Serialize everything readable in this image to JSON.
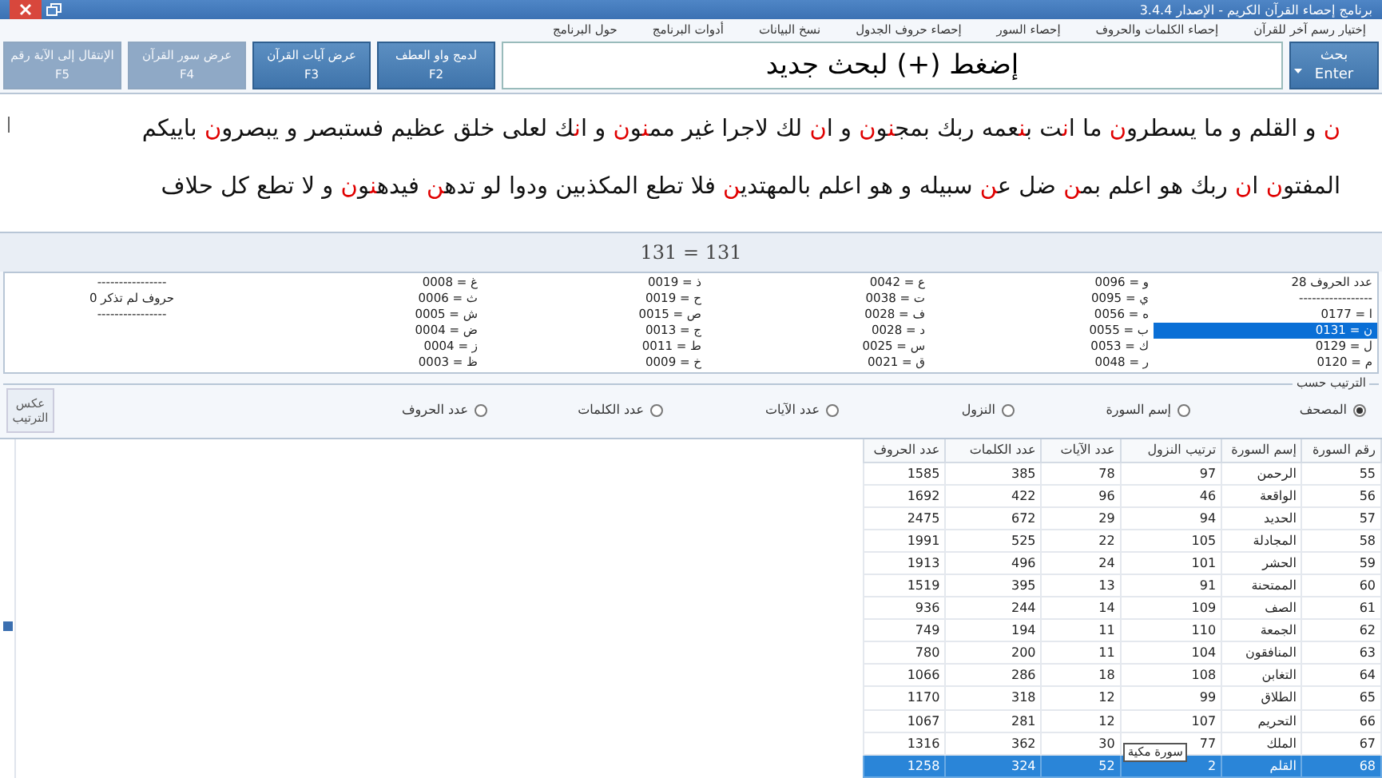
{
  "window": {
    "title": "برنامج إحصاء القرآن الكريم - الإصدار 3.4.4"
  },
  "menu": [
    "إختيار رسم آخر للقرآن",
    "إحصاء الكلمات والحروف",
    "إحصاء السور",
    "إحصاء حروف الجدول",
    "نسخ البيانات",
    "أدوات البرنامج",
    "حول البرنامج"
  ],
  "search_button": {
    "label": "بحث",
    "key": "Enter"
  },
  "search_field": {
    "placeholder": "إضغط (+) لبحث جديد"
  },
  "buttons": [
    {
      "label": "لدمج واو العطف",
      "key": "F2",
      "disabled": false
    },
    {
      "label": "عرض آيات القرآن",
      "key": "F3",
      "disabled": false
    },
    {
      "label": "عرض سور القرآن",
      "key": "F4",
      "disabled": true
    },
    {
      "label": "الإنتقال إلى الآية رقم",
      "key": "F5",
      "disabled": true
    }
  ],
  "verse_lines": [
    [
      {
        "text": "ن",
        "highlight": true
      },
      {
        "text": " و القلم و ما يسطرو",
        "highlight": false
      },
      {
        "text": "ن",
        "highlight": true
      },
      {
        "text": " ما ا",
        "highlight": false
      },
      {
        "text": "ن",
        "highlight": true
      },
      {
        "text": "ت ب",
        "highlight": false
      },
      {
        "text": "ن",
        "highlight": true
      },
      {
        "text": "عمه ربك بمج",
        "highlight": false
      },
      {
        "text": "ن",
        "highlight": true
      },
      {
        "text": "و",
        "highlight": false
      },
      {
        "text": "ن",
        "highlight": true
      },
      {
        "text": " و ا",
        "highlight": false
      },
      {
        "text": "ن",
        "highlight": true
      },
      {
        "text": " لك لاجرا غير مم",
        "highlight": false
      },
      {
        "text": "ن",
        "highlight": true
      },
      {
        "text": "و",
        "highlight": false
      },
      {
        "text": "ن",
        "highlight": true
      },
      {
        "text": " و ا",
        "highlight": false
      },
      {
        "text": "ن",
        "highlight": true
      },
      {
        "text": "ك لعلى خلق عظيم فستبصر و يبصرو",
        "highlight": false
      },
      {
        "text": "ن",
        "highlight": true
      },
      {
        "text": " باييكم",
        "highlight": false
      }
    ],
    [
      {
        "text": "المفتو",
        "highlight": false
      },
      {
        "text": "ن",
        "highlight": true
      },
      {
        "text": " ا",
        "highlight": false
      },
      {
        "text": "ن",
        "highlight": true
      },
      {
        "text": " ربك هو اعلم بم",
        "highlight": false
      },
      {
        "text": "ن",
        "highlight": true
      },
      {
        "text": " ضل ع",
        "highlight": false
      },
      {
        "text": "ن",
        "highlight": true
      },
      {
        "text": " سبيله و هو اعلم بالمهتدي",
        "highlight": false
      },
      {
        "text": "ن",
        "highlight": true
      },
      {
        "text": " فلا تطع المكذبين ودوا لو تده",
        "highlight": false
      },
      {
        "text": "ن",
        "highlight": true
      },
      {
        "text": " فيده",
        "highlight": false
      },
      {
        "text": "ن",
        "highlight": true
      },
      {
        "text": "و",
        "highlight": false
      },
      {
        "text": "ن",
        "highlight": true
      },
      {
        "text": " و لا تطع كل حلاف",
        "highlight": false
      }
    ]
  ],
  "equation": "131  =  131",
  "letter_counts": [
    [
      {
        "text": "عدد الحروف 28",
        "selected": false
      },
      {
        "text": "-----------------",
        "selected": false
      },
      {
        "text": "ا = 0177",
        "selected": false
      },
      {
        "text": "ن = 0131",
        "selected": true
      },
      {
        "text": "ل = 0129",
        "selected": false
      },
      {
        "text": "م = 0120",
        "selected": false
      }
    ],
    [
      {
        "text": "و = 0096",
        "selected": false
      },
      {
        "text": "ي = 0095",
        "selected": false
      },
      {
        "text": "ه = 0056",
        "selected": false
      },
      {
        "text": "ب = 0055",
        "selected": false
      },
      {
        "text": "ك = 0053",
        "selected": false
      },
      {
        "text": "ر = 0048",
        "selected": false
      }
    ],
    [
      {
        "text": "ع = 0042",
        "selected": false
      },
      {
        "text": "ت = 0038",
        "selected": false
      },
      {
        "text": "ف = 0028",
        "selected": false
      },
      {
        "text": "د = 0028",
        "selected": false
      },
      {
        "text": "س = 0025",
        "selected": false
      },
      {
        "text": "ق = 0021",
        "selected": false
      }
    ],
    [
      {
        "text": "ذ = 0019",
        "selected": false
      },
      {
        "text": "ح = 0019",
        "selected": false
      },
      {
        "text": "ص = 0015",
        "selected": false
      },
      {
        "text": "ج = 0013",
        "selected": false
      },
      {
        "text": "ط = 0011",
        "selected": false
      },
      {
        "text": "خ = 0009",
        "selected": false
      }
    ],
    [
      {
        "text": "غ = 0008",
        "selected": false
      },
      {
        "text": "ث = 0006",
        "selected": false
      },
      {
        "text": "ش = 0005",
        "selected": false
      },
      {
        "text": "ض = 0004",
        "selected": false
      },
      {
        "text": "ز = 0004",
        "selected": false
      },
      {
        "text": "ظ = 0003",
        "selected": false
      }
    ],
    [
      {
        "text": "----------------",
        "selected": false
      },
      {
        "text": "حروف لم تذكر 0",
        "selected": false
      },
      {
        "text": "----------------",
        "selected": false
      }
    ]
  ],
  "sort": {
    "title": "الترتيب حسب",
    "options": [
      {
        "label": "المصحف",
        "selected": true
      },
      {
        "label": "إسم السورة",
        "selected": false
      },
      {
        "label": "النزول",
        "selected": false
      },
      {
        "label": "عدد الآيات",
        "selected": false
      },
      {
        "label": "عدد الكلمات",
        "selected": false
      },
      {
        "label": "عدد الحروف",
        "selected": false
      }
    ],
    "reverse_button": "عكس الترتيب"
  },
  "table": {
    "columns": [
      "رقم السورة",
      "إسم السورة",
      "ترتيب النزول",
      "عدد الآيات",
      "عدد الكلمات",
      "عدد الحروف"
    ],
    "rows": [
      {
        "cells": [
          "55",
          "الرحمن",
          "97",
          "78",
          "385",
          "1585"
        ],
        "selected": false
      },
      {
        "cells": [
          "56",
          "الواقعة",
          "46",
          "96",
          "422",
          "1692"
        ],
        "selected": false
      },
      {
        "cells": [
          "57",
          "الحديد",
          "94",
          "29",
          "672",
          "2475"
        ],
        "selected": false
      },
      {
        "cells": [
          "58",
          "المجادلة",
          "105",
          "22",
          "525",
          "1991"
        ],
        "selected": false
      },
      {
        "cells": [
          "59",
          "الحشر",
          "101",
          "24",
          "496",
          "1913"
        ],
        "selected": false
      },
      {
        "cells": [
          "60",
          "الممتحنة",
          "91",
          "13",
          "395",
          "1519"
        ],
        "selected": false
      },
      {
        "cells": [
          "61",
          "الصف",
          "109",
          "14",
          "244",
          "936"
        ],
        "selected": false
      },
      {
        "cells": [
          "62",
          "الجمعة",
          "110",
          "11",
          "194",
          "749"
        ],
        "selected": false
      },
      {
        "cells": [
          "63",
          "المنافقون",
          "104",
          "11",
          "200",
          "780"
        ],
        "selected": false
      },
      {
        "cells": [
          "64",
          "التغابن",
          "108",
          "18",
          "286",
          "1066"
        ],
        "selected": false
      },
      {
        "cells": [
          "65",
          "الطلاق",
          "99",
          "12",
          "318",
          "1170"
        ],
        "selected": false
      },
      {
        "cells": [
          "66",
          "التحريم",
          "107",
          "12",
          "281",
          "1067"
        ],
        "selected": false
      },
      {
        "cells": [
          "67",
          "الملك",
          "77",
          "30",
          "362",
          "1316"
        ],
        "selected": false
      },
      {
        "cells": [
          "68",
          "القلم",
          "2",
          "52",
          "324",
          "1258"
        ],
        "selected": true
      }
    ],
    "tooltip": "سورة مكية"
  }
}
